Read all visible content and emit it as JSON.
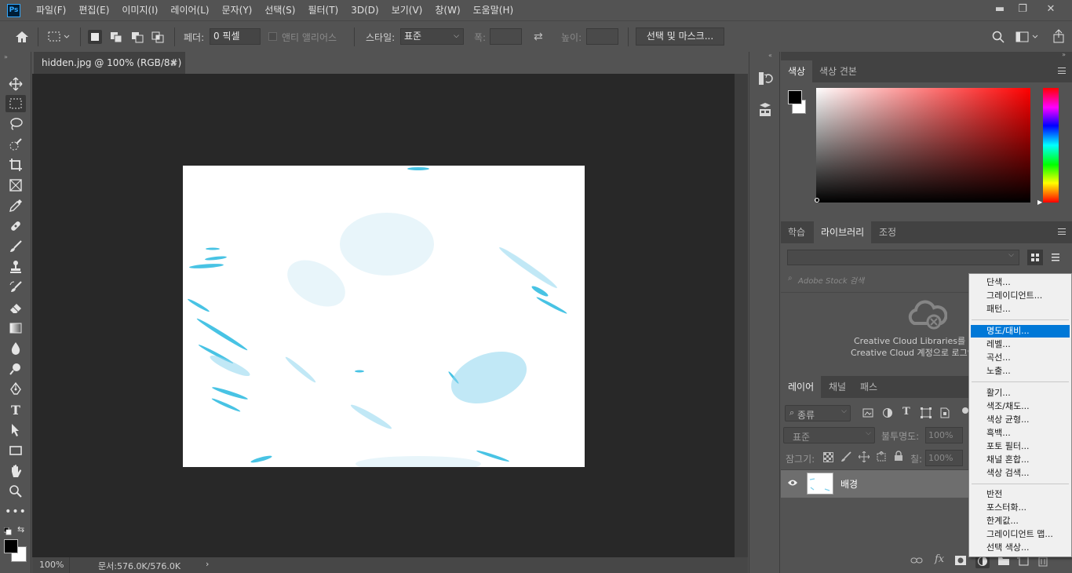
{
  "app": {
    "logo": "Ps"
  },
  "menu": [
    "파일(F)",
    "편집(E)",
    "이미지(I)",
    "레이어(L)",
    "문자(Y)",
    "선택(S)",
    "필터(T)",
    "3D(D)",
    "보기(V)",
    "창(W)",
    "도움말(H)"
  ],
  "window_controls": {
    "minimize": "▬",
    "restore": "❐",
    "close": "✕"
  },
  "options": {
    "feather_label": "페더:",
    "feather_value": "0 픽셀",
    "antialias_label": "앤티 앨리어스",
    "style_label": "스타일:",
    "style_value": "표준",
    "width_label": "폭:",
    "height_label": "높이:",
    "select_mask_button": "선택 및 마스크..."
  },
  "document": {
    "tab_title": "hidden.jpg @ 100% (RGB/8#)",
    "tab_close": "×",
    "zoom": "100%",
    "doc_info": "문서:576.0K/576.0K"
  },
  "color_panel": {
    "tabs": [
      "색상",
      "색상 견본"
    ],
    "active_tab": 0
  },
  "library_panel": {
    "tabs": [
      "학습",
      "라이브러리",
      "조정"
    ],
    "active_tab": 1,
    "search_placeholder": "Adobe Stock 검색",
    "message_line1": "Creative Cloud Libraries를 사용",
    "message_line2": "Creative Cloud 계정으로 로그인"
  },
  "layers_panel": {
    "tabs": [
      "레이어",
      "채널",
      "패스"
    ],
    "active_tab": 0,
    "filter_kind": "종류",
    "blend_mode": "표준",
    "opacity_label": "불투명도:",
    "opacity_value": "100%",
    "lock_label": "잠그기:",
    "fill_label": "칠:",
    "fill_value": "100%",
    "layers": [
      {
        "name": "배경",
        "visible": true
      }
    ]
  },
  "adjustment_menu": {
    "groups": [
      [
        "단색...",
        "그레이디언트...",
        "패턴..."
      ],
      [
        "명도/대비...",
        "레벨...",
        "곡선...",
        "노출..."
      ],
      [
        "활기...",
        "색조/채도...",
        "색상 균형...",
        "흑백...",
        "포토 필터...",
        "채널 혼합...",
        "색상 검색..."
      ],
      [
        "반전",
        "포스터화...",
        "한계값...",
        "그레이디언트 맵...",
        "선택 색상..."
      ]
    ],
    "highlighted": "명도/대비..."
  },
  "colors": {
    "foreground": "#000000",
    "background": "#ffffff",
    "picker_hue": "#ff0000",
    "highlight": "#0078d7"
  }
}
